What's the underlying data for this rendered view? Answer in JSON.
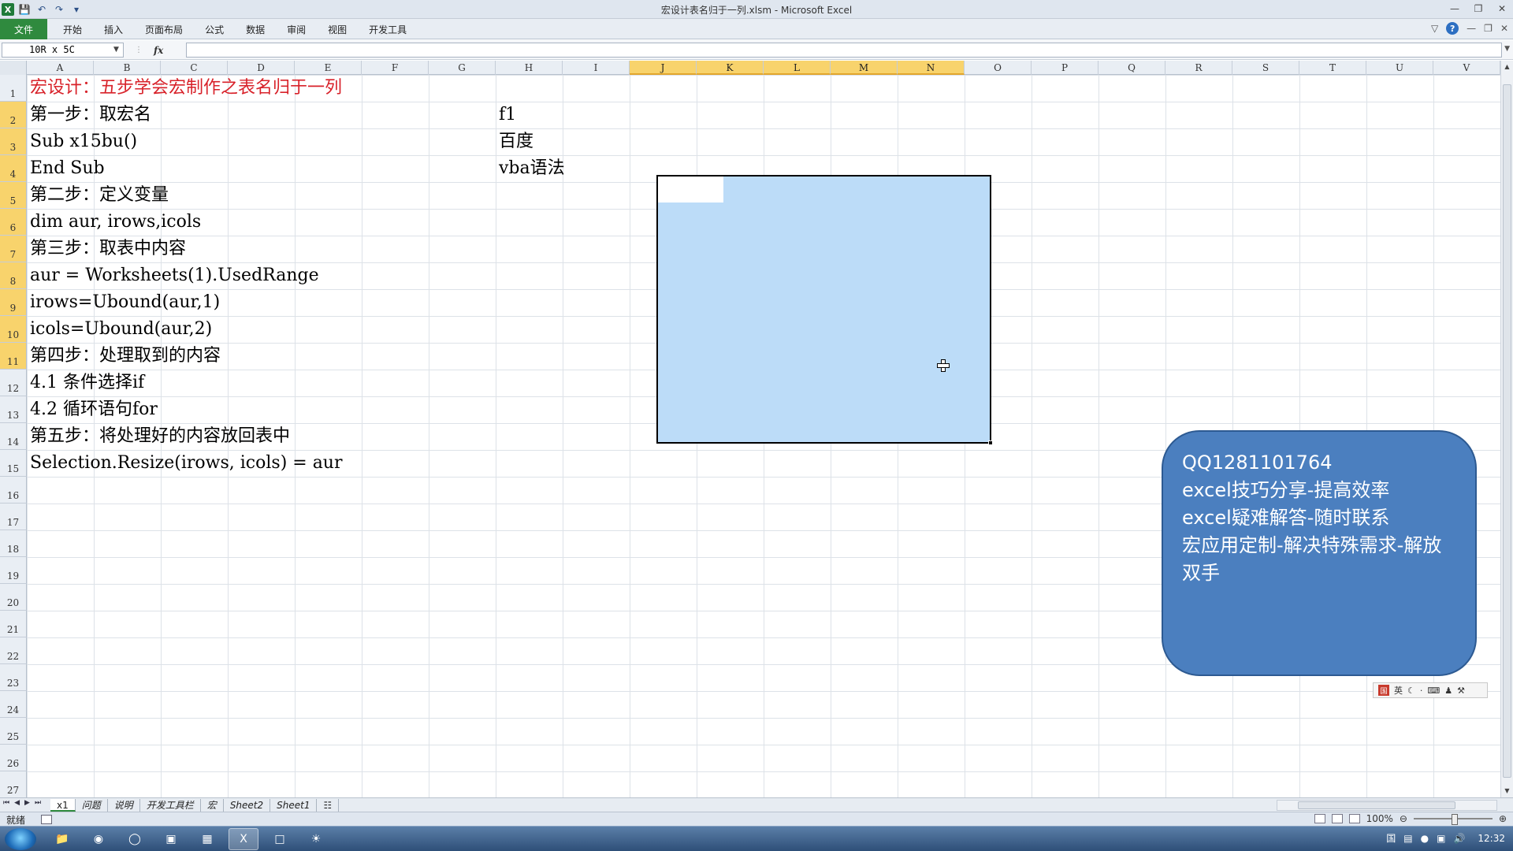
{
  "window": {
    "title": "宏设计表名归于一列.xlsm - Microsoft Excel",
    "app_icon": "X"
  },
  "ribbon": {
    "tabs": [
      "文件",
      "开始",
      "插入",
      "页面布局",
      "公式",
      "数据",
      "审阅",
      "视图",
      "开发工具"
    ]
  },
  "formula_bar": {
    "name_box": "10R x 5C",
    "fx_label": "fx",
    "formula": ""
  },
  "columns": [
    "A",
    "B",
    "C",
    "D",
    "E",
    "F",
    "G",
    "H",
    "I",
    "J",
    "K",
    "L",
    "M",
    "N",
    "O",
    "P",
    "Q",
    "R",
    "S",
    "T",
    "U",
    "V"
  ],
  "selected_columns": [
    "J",
    "K",
    "L",
    "M",
    "N"
  ],
  "rows": [
    "1",
    "2",
    "3",
    "4",
    "5",
    "6",
    "7",
    "8",
    "9",
    "10",
    "11",
    "12",
    "13",
    "14",
    "15",
    "16",
    "17",
    "18",
    "19",
    "20",
    "21",
    "22",
    "23",
    "24",
    "25",
    "26",
    "27"
  ],
  "selected_rows": [
    "2",
    "3",
    "4",
    "5",
    "6",
    "7",
    "8",
    "9",
    "10",
    "11"
  ],
  "cells": {
    "A1": "宏设计：五步学会宏制作之表名归于一列",
    "A2": "第一步：取宏名",
    "A3": "Sub x15bu()",
    "A4": "End Sub",
    "A5": "第二步：定义变量",
    "A6": "dim aur, irows,icols",
    "A7": "第三步：取表中内容",
    "A8": "aur = Worksheets(1).UsedRange",
    "A9": "irows=Ubound(aur,1)",
    "A10": "icols=Ubound(aur,2)",
    "A11": "第四步：处理取到的内容",
    "A12": "4.1 条件选择if",
    "A13": "4.2 循环语句for",
    "A14": "第五步：将处理好的内容放回表中",
    "A15": "Selection.Resize(irows, icols) = aur",
    "H2": "f1",
    "H3": "百度",
    "H4": "vba语法"
  },
  "info_box": {
    "lines": [
      "QQ1281101764",
      "excel技巧分享-提高效率",
      "excel疑难解答-随时联系",
      "宏应用定制-解决特殊需求-解放双手"
    ]
  },
  "ime_bar": {
    "mode": "英"
  },
  "sheets": {
    "tabs": [
      "x1",
      "问题",
      "说明",
      "开发工具栏",
      "宏",
      "Sheet2",
      "Sheet1"
    ],
    "active": "x1"
  },
  "status": {
    "text": "就绪",
    "zoom": "100%"
  },
  "taskbar": {
    "clock": "12:32"
  },
  "colors": {
    "title_red": "#d8222a",
    "selection_blue": "#bcdcf8",
    "info_box_blue": "#4b7fbf",
    "header_highlight": "#f8d36c",
    "file_tab_green": "#2f8a3e"
  }
}
